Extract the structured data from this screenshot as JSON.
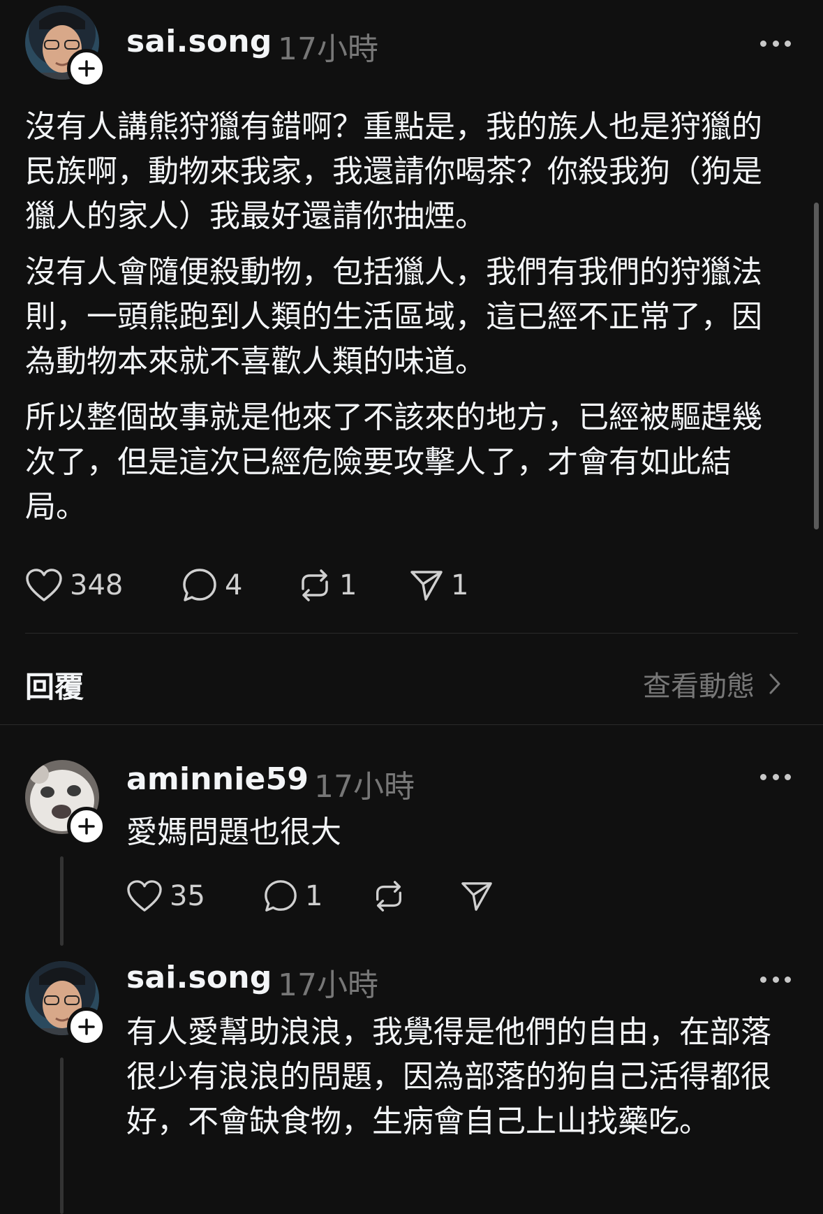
{
  "main_post": {
    "username": "sai.song",
    "time": "17小時",
    "paragraphs": [
      "沒有人講熊狩獵有錯啊？重點是，我的族人也是狩獵的民族啊，動物來我家，我還請你喝茶？你殺我狗（狗是獵人的家人）我最好還請你抽煙。",
      "沒有人會隨便殺動物，包括獵人，我們有我們的狩獵法則，一頭熊跑到人類的生活區域，這已經不正常了，因為動物本來就不喜歡人類的味道。",
      "所以整個故事就是他來了不該來的地方，已經被驅趕幾次了，但是這次已經危險要攻擊人了，才會有如此結局。"
    ],
    "likes": "348",
    "comments": "4",
    "reposts": "1",
    "shares": "1"
  },
  "replies_header": {
    "label": "回覆",
    "view_activity": "查看動態"
  },
  "replies": [
    {
      "username": "aminnie59",
      "time": "17小時",
      "text": "愛媽問題也很大",
      "likes": "35",
      "comments": "1"
    },
    {
      "username": "sai.song",
      "time": "17小時",
      "text": "有人愛幫助浪浪，我覺得是他們的自由，在部落很少有浪浪的問題，因為部落的狗自己活得都很好，不會缺食物，生病會自己上山找藥吃。"
    }
  ],
  "colors": {
    "background": "#101010",
    "text": "#f3f5f7",
    "muted": "#777777"
  },
  "icons": [
    "heart-icon",
    "comment-icon",
    "repost-icon",
    "share-icon",
    "more-icon",
    "plus-icon",
    "chevron-right-icon"
  ]
}
